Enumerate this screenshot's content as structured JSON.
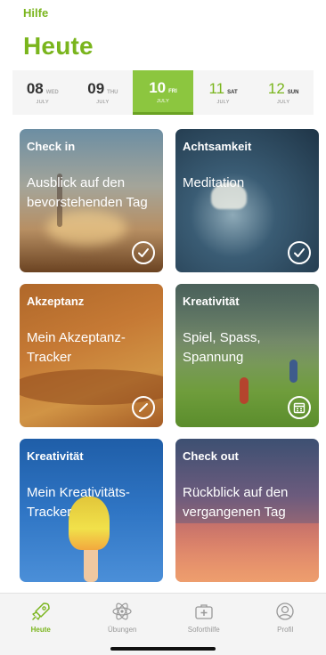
{
  "header": {
    "help_label": "Hilfe",
    "title": "Heute"
  },
  "dates": [
    {
      "day": "08",
      "weekday": "WED",
      "month": "JULY",
      "state": "past"
    },
    {
      "day": "09",
      "weekday": "THU",
      "month": "JULY",
      "state": "past"
    },
    {
      "day": "10",
      "weekday": "FRI",
      "month": "JULY",
      "state": "active"
    },
    {
      "day": "11",
      "weekday": "SAT",
      "month": "JULY",
      "state": "future"
    },
    {
      "day": "12",
      "weekday": "SUN",
      "month": "JULY",
      "state": "future"
    }
  ],
  "cards": [
    {
      "category": "Check in",
      "title": "Ausblick auf den bevorstehenden Tag",
      "badge": "check-icon"
    },
    {
      "category": "Achtsamkeit",
      "title": "Meditation",
      "badge": "check-icon"
    },
    {
      "category": "Akzeptanz",
      "title": "Mein Akzeptanz-Tracker",
      "badge": "pencil-icon"
    },
    {
      "category": "Kreativität",
      "title": "Spiel, Spass, Spannung",
      "badge": "calendar-icon"
    },
    {
      "category": "Kreativität",
      "title": "Mein Kreativitäts-Tracker",
      "badge": ""
    },
    {
      "category": "Check out",
      "title": "Rückblick auf den vergangenen Tag",
      "badge": ""
    }
  ],
  "tabs": [
    {
      "label": "Heute",
      "icon": "rocket-icon",
      "active": true
    },
    {
      "label": "Übungen",
      "icon": "atom-icon",
      "active": false
    },
    {
      "label": "Soforthilfe",
      "icon": "first-aid-kit-icon",
      "active": false
    },
    {
      "label": "Profil",
      "icon": "profile-icon",
      "active": false
    }
  ],
  "colors": {
    "accent": "#7ab51d",
    "active_date_bg": "#8cc63f"
  }
}
